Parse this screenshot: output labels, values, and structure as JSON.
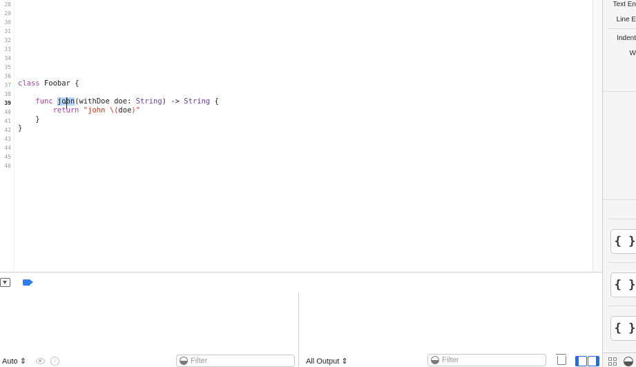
{
  "editor": {
    "line_numbers": [
      "28",
      "29",
      "30",
      "31",
      "32",
      "33",
      "34",
      "35",
      "36",
      "37",
      "38",
      "39",
      "40",
      "41",
      "42",
      "43",
      "44",
      "45",
      "46"
    ],
    "current_line": "39",
    "code": {
      "l37_kw": "class",
      "l37_rest": " Foobar {",
      "l39_indent": "    ",
      "l39_kw": "func",
      "l39_space": " ",
      "l39_name": "john",
      "l39_mid": "(withDoe doe: ",
      "l39_type1": "String",
      "l39_arrow": ") -> ",
      "l39_type2": "String",
      "l39_end": " {",
      "l40_indent": "        ",
      "l40_kw": "return",
      "l40_sp": " ",
      "l40_str_a": "\"john \\(",
      "l40_interp": "doe",
      "l40_str_b": ")\"",
      "l41": "    }",
      "l42": "}"
    }
  },
  "inspector": {
    "text_encoding": "Text En",
    "line_endings": "Line E",
    "indent": "Indent",
    "w": "W",
    "snippet_glyph": "{ }"
  },
  "debug": {
    "variables_mode": "Auto",
    "filter_placeholder": "Filter",
    "output_mode": "All Output",
    "updown_glyph": "⇕",
    "info_glyph": "i"
  }
}
